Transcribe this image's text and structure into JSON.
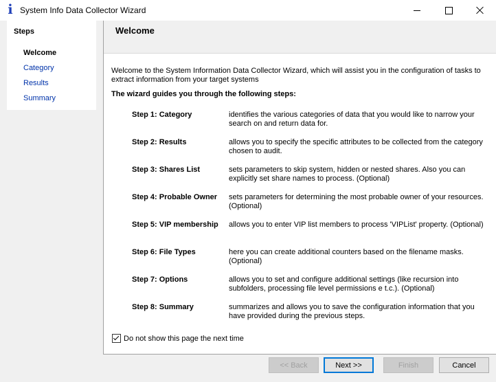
{
  "window": {
    "title": "System Info Data Collector Wizard"
  },
  "sidebar": {
    "title": "Steps",
    "items": [
      {
        "label": "Welcome",
        "active": true
      },
      {
        "label": "Category",
        "active": false
      },
      {
        "label": "Results",
        "active": false
      },
      {
        "label": "Summary",
        "active": false
      }
    ]
  },
  "page": {
    "title": "Welcome",
    "intro": "Welcome to the System Information Data Collector Wizard, which will assist you in the configuration of tasks to extract information from your target systems",
    "guide_heading": "The wizard guides you through the following steps:",
    "steps": [
      {
        "name": "Step 1: Category",
        "desc": "identifies the various categories of data that you would like to narrow your search on and return data for."
      },
      {
        "name": "Step 2: Results",
        "desc": "allows you to specify the specific attributes to be collected from the category chosen to audit."
      },
      {
        "name": "Step 3: Shares List",
        "desc": "sets parameters to skip system, hidden or nested shares. Also you can explicitly set share names to process. (Optional)"
      },
      {
        "name": "Step 4: Probable Owner",
        "desc": "sets parameters for determining the most probable owner of your resources. (Optional)"
      },
      {
        "name": "Step 5: VIP membership",
        "desc": "allows you to enter VIP list members to process 'VIPList' property. (Optional)"
      },
      {
        "name": "Step 6: File Types",
        "desc": "here you can create additional counters based on the filename masks. (Optional)"
      },
      {
        "name": "Step 7: Options",
        "desc": "allows you to set and configure additional settings (like recursion into subfolders, processing file level permissions e t.c.). (Optional)"
      },
      {
        "name": "Step 8: Summary",
        "desc": "summarizes and allows you to save the configuration information that you have provided during the previous steps."
      }
    ],
    "checkbox_label": "Do not show this page the next time",
    "checkbox_checked": true
  },
  "buttons": {
    "back": "<< Back",
    "next": "Next >>",
    "finish": "Finish",
    "cancel": "Cancel"
  }
}
